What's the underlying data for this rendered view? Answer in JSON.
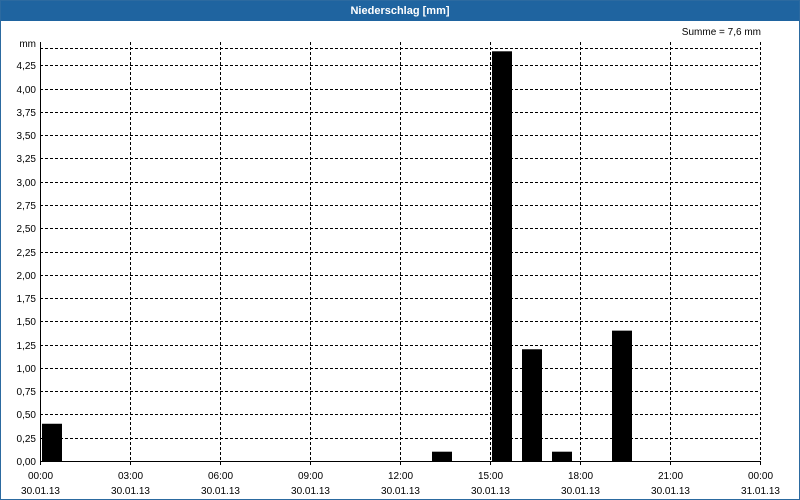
{
  "window": {
    "title": "Niederschlag [mm]"
  },
  "summary": "Summe = 7,6 mm",
  "chart_data": {
    "type": "bar",
    "title": "Niederschlag [mm]",
    "ylabel": "mm",
    "ylim": [
      0,
      4.5
    ],
    "y_ticks": [
      "0,00",
      "0,25",
      "0,50",
      "0,75",
      "1,00",
      "1,25",
      "1,50",
      "1,75",
      "2,00",
      "2,25",
      "2,50",
      "2,75",
      "3,00",
      "3,25",
      "3,50",
      "3,75",
      "4,00",
      "4,25"
    ],
    "y_tick_values": [
      0,
      0.25,
      0.5,
      0.75,
      1.0,
      1.25,
      1.5,
      1.75,
      2.0,
      2.25,
      2.5,
      2.75,
      3.0,
      3.25,
      3.5,
      3.75,
      4.0,
      4.25
    ],
    "x_range_hours": [
      0,
      24
    ],
    "x_ticks": [
      {
        "time": "00:00",
        "date": "30.01.13",
        "hour": 0
      },
      {
        "time": "03:00",
        "date": "30.01.13",
        "hour": 3
      },
      {
        "time": "06:00",
        "date": "30.01.13",
        "hour": 6
      },
      {
        "time": "09:00",
        "date": "30.01.13",
        "hour": 9
      },
      {
        "time": "12:00",
        "date": "30.01.13",
        "hour": 12
      },
      {
        "time": "15:00",
        "date": "30.01.13",
        "hour": 15
      },
      {
        "time": "18:00",
        "date": "30.01.13",
        "hour": 18
      },
      {
        "time": "21:00",
        "date": "30.01.13",
        "hour": 21
      },
      {
        "time": "00:00",
        "date": "31.01.13",
        "hour": 24
      }
    ],
    "bars": [
      {
        "hour": 0,
        "value": 0.4
      },
      {
        "hour": 13,
        "value": 0.1
      },
      {
        "hour": 15,
        "value": 4.4
      },
      {
        "hour": 16,
        "value": 1.2
      },
      {
        "hour": 17,
        "value": 0.1
      },
      {
        "hour": 19,
        "value": 1.4
      }
    ],
    "bar_color": "#000000",
    "grid": true
  }
}
